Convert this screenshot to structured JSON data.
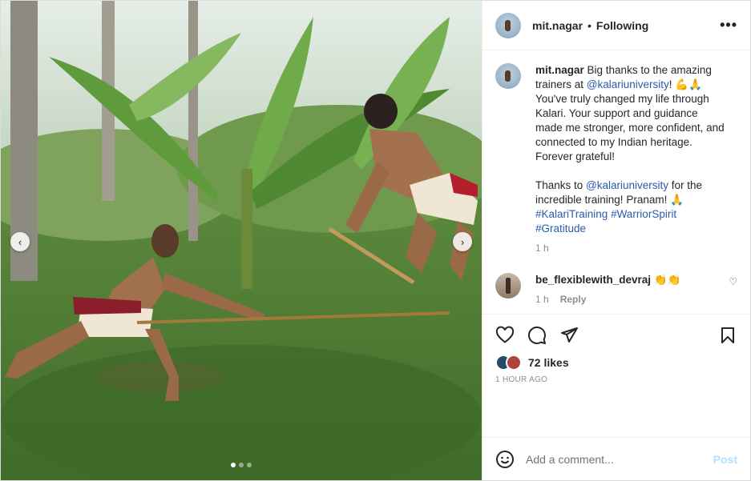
{
  "header": {
    "username": "mit.nagar",
    "separator": "•",
    "follow_status": "Following",
    "more_icon": "more-horizontal-icon"
  },
  "caption": {
    "username": "mit.nagar",
    "text_1": "Big thanks to the amazing trainers at",
    "mention_1": "@kalariuniversity",
    "text_2": "! 💪🙏 You've truly changed my life through Kalari. Your support and guidance made me stronger, more confident, and connected to my Indian heritage. Forever grateful!",
    "text_3": "Thanks to",
    "mention_2": "@kalariuniversity",
    "text_4": "for the incredible training! Pranam! 🙏",
    "hashtag_1": "#KalariTraining",
    "hashtag_2": "#WarriorSpirit",
    "hashtag_3": "#Gratitude",
    "time": "1 h"
  },
  "comment": {
    "username": "be_flexiblewith_devraj",
    "text": "👏👏",
    "time": "1 h",
    "reply": "Reply",
    "like_icon": "heart-icon"
  },
  "actions": {
    "like_icon": "heart-icon",
    "comment_icon": "comment-icon",
    "share_icon": "send-icon",
    "save_icon": "bookmark-icon",
    "likes": "72 likes",
    "time_ago": "1 HOUR AGO"
  },
  "add_comment": {
    "emoji_icon": "smiley-icon",
    "placeholder": "Add a comment...",
    "post": "Post"
  },
  "carousel": {
    "prev_icon": "chevron-left-icon",
    "next_icon": "chevron-right-icon",
    "current_index": 0,
    "total": 3
  },
  "colors": {
    "link": "#00376b",
    "post_disabled": "#b2dffc",
    "meta": "#8e8e8e"
  }
}
